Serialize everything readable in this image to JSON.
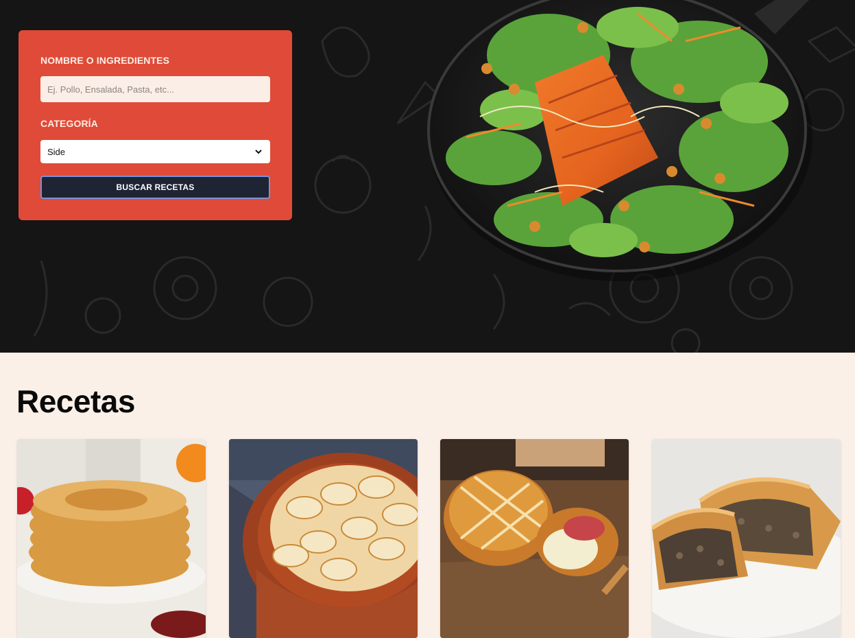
{
  "search_form": {
    "name_label": "NOMBRE O INGREDIENTES",
    "name_placeholder": "Ej. Pollo, Ensalada, Pasta, etc...",
    "category_label": "CATEGORÍA",
    "category_selected": "Side",
    "submit_label": "BUSCAR RECETAS"
  },
  "recipes": {
    "title": "Recetas",
    "cards": [
      {
        "image": "pancakes-image"
      },
      {
        "image": "potato-gratin-image"
      },
      {
        "image": "baked-brie-pastry-image"
      },
      {
        "image": "meat-pie-image"
      }
    ]
  },
  "colors": {
    "hero_bg": "#151515",
    "panel_bg": "#e04a38",
    "button_bg": "#1e2434",
    "page_bg": "#faf0e8"
  }
}
